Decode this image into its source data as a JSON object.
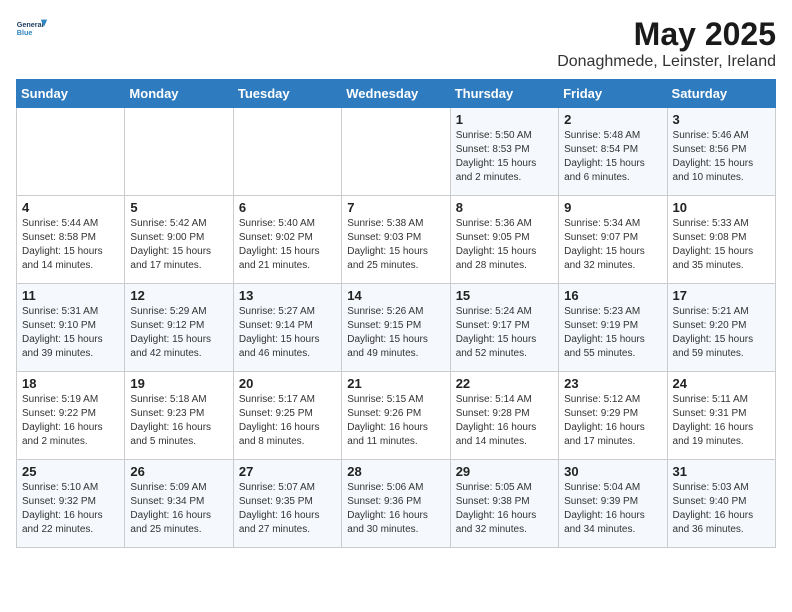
{
  "logo": {
    "line1": "General",
    "line2": "Blue"
  },
  "title": "May 2025",
  "subtitle": "Donaghmede, Leinster, Ireland",
  "days_of_week": [
    "Sunday",
    "Monday",
    "Tuesday",
    "Wednesday",
    "Thursday",
    "Friday",
    "Saturday"
  ],
  "weeks": [
    [
      {
        "day": "",
        "info": ""
      },
      {
        "day": "",
        "info": ""
      },
      {
        "day": "",
        "info": ""
      },
      {
        "day": "",
        "info": ""
      },
      {
        "day": "1",
        "info": "Sunrise: 5:50 AM\nSunset: 8:53 PM\nDaylight: 15 hours\nand 2 minutes."
      },
      {
        "day": "2",
        "info": "Sunrise: 5:48 AM\nSunset: 8:54 PM\nDaylight: 15 hours\nand 6 minutes."
      },
      {
        "day": "3",
        "info": "Sunrise: 5:46 AM\nSunset: 8:56 PM\nDaylight: 15 hours\nand 10 minutes."
      }
    ],
    [
      {
        "day": "4",
        "info": "Sunrise: 5:44 AM\nSunset: 8:58 PM\nDaylight: 15 hours\nand 14 minutes."
      },
      {
        "day": "5",
        "info": "Sunrise: 5:42 AM\nSunset: 9:00 PM\nDaylight: 15 hours\nand 17 minutes."
      },
      {
        "day": "6",
        "info": "Sunrise: 5:40 AM\nSunset: 9:02 PM\nDaylight: 15 hours\nand 21 minutes."
      },
      {
        "day": "7",
        "info": "Sunrise: 5:38 AM\nSunset: 9:03 PM\nDaylight: 15 hours\nand 25 minutes."
      },
      {
        "day": "8",
        "info": "Sunrise: 5:36 AM\nSunset: 9:05 PM\nDaylight: 15 hours\nand 28 minutes."
      },
      {
        "day": "9",
        "info": "Sunrise: 5:34 AM\nSunset: 9:07 PM\nDaylight: 15 hours\nand 32 minutes."
      },
      {
        "day": "10",
        "info": "Sunrise: 5:33 AM\nSunset: 9:08 PM\nDaylight: 15 hours\nand 35 minutes."
      }
    ],
    [
      {
        "day": "11",
        "info": "Sunrise: 5:31 AM\nSunset: 9:10 PM\nDaylight: 15 hours\nand 39 minutes."
      },
      {
        "day": "12",
        "info": "Sunrise: 5:29 AM\nSunset: 9:12 PM\nDaylight: 15 hours\nand 42 minutes."
      },
      {
        "day": "13",
        "info": "Sunrise: 5:27 AM\nSunset: 9:14 PM\nDaylight: 15 hours\nand 46 minutes."
      },
      {
        "day": "14",
        "info": "Sunrise: 5:26 AM\nSunset: 9:15 PM\nDaylight: 15 hours\nand 49 minutes."
      },
      {
        "day": "15",
        "info": "Sunrise: 5:24 AM\nSunset: 9:17 PM\nDaylight: 15 hours\nand 52 minutes."
      },
      {
        "day": "16",
        "info": "Sunrise: 5:23 AM\nSunset: 9:19 PM\nDaylight: 15 hours\nand 55 minutes."
      },
      {
        "day": "17",
        "info": "Sunrise: 5:21 AM\nSunset: 9:20 PM\nDaylight: 15 hours\nand 59 minutes."
      }
    ],
    [
      {
        "day": "18",
        "info": "Sunrise: 5:19 AM\nSunset: 9:22 PM\nDaylight: 16 hours\nand 2 minutes."
      },
      {
        "day": "19",
        "info": "Sunrise: 5:18 AM\nSunset: 9:23 PM\nDaylight: 16 hours\nand 5 minutes."
      },
      {
        "day": "20",
        "info": "Sunrise: 5:17 AM\nSunset: 9:25 PM\nDaylight: 16 hours\nand 8 minutes."
      },
      {
        "day": "21",
        "info": "Sunrise: 5:15 AM\nSunset: 9:26 PM\nDaylight: 16 hours\nand 11 minutes."
      },
      {
        "day": "22",
        "info": "Sunrise: 5:14 AM\nSunset: 9:28 PM\nDaylight: 16 hours\nand 14 minutes."
      },
      {
        "day": "23",
        "info": "Sunrise: 5:12 AM\nSunset: 9:29 PM\nDaylight: 16 hours\nand 17 minutes."
      },
      {
        "day": "24",
        "info": "Sunrise: 5:11 AM\nSunset: 9:31 PM\nDaylight: 16 hours\nand 19 minutes."
      }
    ],
    [
      {
        "day": "25",
        "info": "Sunrise: 5:10 AM\nSunset: 9:32 PM\nDaylight: 16 hours\nand 22 minutes."
      },
      {
        "day": "26",
        "info": "Sunrise: 5:09 AM\nSunset: 9:34 PM\nDaylight: 16 hours\nand 25 minutes."
      },
      {
        "day": "27",
        "info": "Sunrise: 5:07 AM\nSunset: 9:35 PM\nDaylight: 16 hours\nand 27 minutes."
      },
      {
        "day": "28",
        "info": "Sunrise: 5:06 AM\nSunset: 9:36 PM\nDaylight: 16 hours\nand 30 minutes."
      },
      {
        "day": "29",
        "info": "Sunrise: 5:05 AM\nSunset: 9:38 PM\nDaylight: 16 hours\nand 32 minutes."
      },
      {
        "day": "30",
        "info": "Sunrise: 5:04 AM\nSunset: 9:39 PM\nDaylight: 16 hours\nand 34 minutes."
      },
      {
        "day": "31",
        "info": "Sunrise: 5:03 AM\nSunset: 9:40 PM\nDaylight: 16 hours\nand 36 minutes."
      }
    ]
  ]
}
